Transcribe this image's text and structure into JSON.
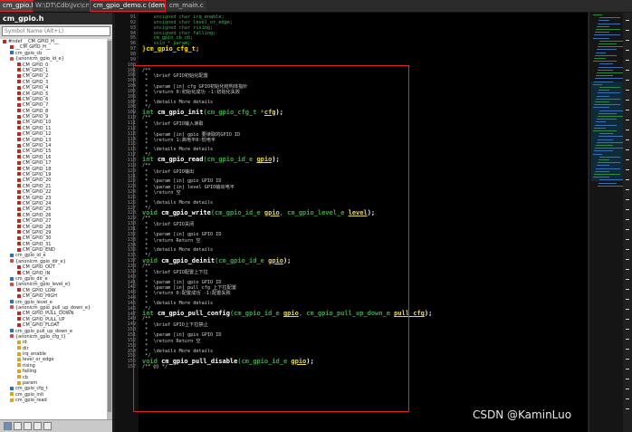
{
  "tabs": [
    {
      "label": "cm_gpio.h",
      "active": true
    },
    {
      "label": "W:\\DT\\Cdb\\Jvc\\cm\\",
      "active": false
    },
    {
      "label": "cm_gpio_demo.c (demo)",
      "active": true
    },
    {
      "label": "cm_main.c",
      "active": false
    }
  ],
  "symbol_panel": {
    "title": "cm_gpio.h",
    "search_placeholder": "Symbol Name (Alt+L)",
    "items": [
      {
        "label": "#ndef __CM_GPIO_H__",
        "icon": "define-icon",
        "depth": 0
      },
      {
        "label": "__CM_GPIO_H__",
        "icon": "define-icon",
        "depth": 1
      },
      {
        "label": "cm_gpio_cb",
        "icon": "type-icon",
        "depth": 1
      },
      {
        "label": "{anonicm_gpio_id_e}",
        "icon": "enum-icon",
        "depth": 1
      },
      {
        "label": "CM_GPIO_0",
        "icon": "define-icon",
        "depth": 2
      },
      {
        "label": "CM_GPIO_1",
        "icon": "define-icon",
        "depth": 2
      },
      {
        "label": "CM_GPIO_2",
        "icon": "define-icon",
        "depth": 2
      },
      {
        "label": "CM_GPIO_3",
        "icon": "define-icon",
        "depth": 2
      },
      {
        "label": "CM_GPIO_4",
        "icon": "define-icon",
        "depth": 2
      },
      {
        "label": "CM_GPIO_5",
        "icon": "define-icon",
        "depth": 2
      },
      {
        "label": "CM_GPIO_6",
        "icon": "define-icon",
        "depth": 2
      },
      {
        "label": "CM_GPIO_7",
        "icon": "define-icon",
        "depth": 2
      },
      {
        "label": "CM_GPIO_8",
        "icon": "define-icon",
        "depth": 2
      },
      {
        "label": "CM_GPIO_9",
        "icon": "define-icon",
        "depth": 2
      },
      {
        "label": "CM_GPIO_10",
        "icon": "define-icon",
        "depth": 2
      },
      {
        "label": "CM_GPIO_11",
        "icon": "define-icon",
        "depth": 2
      },
      {
        "label": "CM_GPIO_12",
        "icon": "define-icon",
        "depth": 2
      },
      {
        "label": "CM_GPIO_13",
        "icon": "define-icon",
        "depth": 2
      },
      {
        "label": "CM_GPIO_14",
        "icon": "define-icon",
        "depth": 2
      },
      {
        "label": "CM_GPIO_15",
        "icon": "define-icon",
        "depth": 2
      },
      {
        "label": "CM_GPIO_16",
        "icon": "define-icon",
        "depth": 2
      },
      {
        "label": "CM_GPIO_17",
        "icon": "define-icon",
        "depth": 2
      },
      {
        "label": "CM_GPIO_18",
        "icon": "define-icon",
        "depth": 2
      },
      {
        "label": "CM_GPIO_19",
        "icon": "define-icon",
        "depth": 2
      },
      {
        "label": "CM_GPIO_20",
        "icon": "define-icon",
        "depth": 2
      },
      {
        "label": "CM_GPIO_21",
        "icon": "define-icon",
        "depth": 2
      },
      {
        "label": "CM_GPIO_22",
        "icon": "define-icon",
        "depth": 2
      },
      {
        "label": "CM_GPIO_23",
        "icon": "define-icon",
        "depth": 2
      },
      {
        "label": "CM_GPIO_24",
        "icon": "define-icon",
        "depth": 2
      },
      {
        "label": "CM_GPIO_25",
        "icon": "define-icon",
        "depth": 2
      },
      {
        "label": "CM_GPIO_26",
        "icon": "define-icon",
        "depth": 2
      },
      {
        "label": "CM_GPIO_27",
        "icon": "define-icon",
        "depth": 2
      },
      {
        "label": "CM_GPIO_28",
        "icon": "define-icon",
        "depth": 2
      },
      {
        "label": "CM_GPIO_29",
        "icon": "define-icon",
        "depth": 2
      },
      {
        "label": "CM_GPIO_30",
        "icon": "define-icon",
        "depth": 2
      },
      {
        "label": "CM_GPIO_31",
        "icon": "define-icon",
        "depth": 2
      },
      {
        "label": "CM_GPIO_END",
        "icon": "define-icon",
        "depth": 2
      },
      {
        "label": "cm_gpio_id_e",
        "icon": "type-icon",
        "depth": 1
      },
      {
        "label": "{anonicm_gpio_dir_e}",
        "icon": "enum-icon",
        "depth": 1
      },
      {
        "label": "CM_GPIO_OUT",
        "icon": "define-icon",
        "depth": 2
      },
      {
        "label": "CM_GPIO_IN",
        "icon": "define-icon",
        "depth": 2
      },
      {
        "label": "cm_gpio_dir_e",
        "icon": "type-icon",
        "depth": 1
      },
      {
        "label": "{anonicm_gpio_level_e}",
        "icon": "enum-icon",
        "depth": 1
      },
      {
        "label": "CM_GPIO_LOW",
        "icon": "define-icon",
        "depth": 2
      },
      {
        "label": "CM_GPIO_HIGH",
        "icon": "define-icon",
        "depth": 2
      },
      {
        "label": "cm_gpio_level_e",
        "icon": "type-icon",
        "depth": 1
      },
      {
        "label": "{anonicm_gpio_pull_up_down_e}",
        "icon": "enum-icon",
        "depth": 1
      },
      {
        "label": "CM_GPIO_PULL_DOWN",
        "icon": "define-icon",
        "depth": 2
      },
      {
        "label": "CM_GPIO_PULL_UP",
        "icon": "define-icon",
        "depth": 2
      },
      {
        "label": "CM_GPIO_FLOAT",
        "icon": "define-icon",
        "depth": 2
      },
      {
        "label": "cm_gpio_pull_up_down_e",
        "icon": "type-icon",
        "depth": 1
      },
      {
        "label": "{anonicm_gpio_cfg_t}",
        "icon": "enum-icon",
        "depth": 1
      },
      {
        "label": "id",
        "icon": "field-icon",
        "depth": 2
      },
      {
        "label": "dir",
        "icon": "field-icon",
        "depth": 2
      },
      {
        "label": "irq_enable",
        "icon": "field-icon",
        "depth": 2
      },
      {
        "label": "level_or_edge",
        "icon": "field-icon",
        "depth": 2
      },
      {
        "label": "rising",
        "icon": "field-icon",
        "depth": 2
      },
      {
        "label": "falling",
        "icon": "field-icon",
        "depth": 2
      },
      {
        "label": "cb",
        "icon": "field-icon",
        "depth": 2
      },
      {
        "label": "param",
        "icon": "field-icon",
        "depth": 2
      },
      {
        "label": "cm_gpio_cfg_t",
        "icon": "type-icon",
        "depth": 1
      },
      {
        "label": "cm_gpio_init",
        "icon": "field-icon",
        "depth": 1
      },
      {
        "label": "cm_gpio_read",
        "icon": "field-icon",
        "depth": 1
      }
    ]
  },
  "editor": {
    "lines": [
      {
        "n": "91",
        "tokens": [
          {
            "t": "    unsigned char ",
            "c": "kw"
          },
          {
            "t": "irq_enable;",
            "c": "ty"
          }
        ]
      },
      {
        "n": "92",
        "tokens": [
          {
            "t": "    unsigned char ",
            "c": "kw"
          },
          {
            "t": "level_or_edge;",
            "c": "ty"
          }
        ]
      },
      {
        "n": "93",
        "tokens": [
          {
            "t": "    unsigned char ",
            "c": "kw"
          },
          {
            "t": "rising;",
            "c": "ty"
          }
        ]
      },
      {
        "n": "94",
        "tokens": [
          {
            "t": "    unsigned char ",
            "c": "kw"
          },
          {
            "t": "falling;",
            "c": "ty"
          }
        ]
      },
      {
        "n": "95",
        "tokens": [
          {
            "t": "    cm_gpio_cb cb;",
            "c": "ty"
          }
        ]
      },
      {
        "n": "96",
        "tokens": [
          {
            "t": "    void * ",
            "c": "kw"
          },
          {
            "t": "param;",
            "c": "ty"
          }
        ]
      },
      {
        "n": "97",
        "big": true,
        "tokens": [
          {
            "t": "}",
            "c": "yl"
          },
          {
            "t": "cm_gpio_cfg_t",
            "c": "yl"
          },
          {
            "t": ";",
            "c": "yl"
          }
        ]
      },
      {
        "n": "98",
        "tokens": []
      },
      {
        "n": "99",
        "tokens": []
      },
      {
        "n": "100",
        "tokens": []
      },
      {
        "n": "101",
        "tokens": [
          {
            "t": "/**",
            "c": "cm"
          }
        ]
      },
      {
        "n": "102",
        "tokens": [
          {
            "t": " *  \\brief GPIO初始化配置",
            "c": "cm"
          }
        ]
      },
      {
        "n": "103",
        "tokens": [
          {
            "t": " *",
            "c": "cm"
          }
        ]
      },
      {
        "n": "104",
        "tokens": [
          {
            "t": " *  \\param [in] cfg GPIO初始化结构体指针",
            "c": "cm"
          }
        ]
      },
      {
        "n": "105",
        "tokens": [
          {
            "t": " *  \\return 0:初始化成功 -1:初始化失败",
            "c": "cm"
          }
        ]
      },
      {
        "n": "106",
        "tokens": [
          {
            "t": " *",
            "c": "cm"
          }
        ]
      },
      {
        "n": "107",
        "tokens": [
          {
            "t": " *  \\details More details",
            "c": "cm"
          }
        ]
      },
      {
        "n": "108",
        "tokens": [
          {
            "t": " */",
            "c": "cm"
          }
        ]
      },
      {
        "n": "109",
        "big": true,
        "tokens": [
          {
            "t": "int ",
            "c": "kw"
          },
          {
            "t": "cm_gpio_init",
            "c": "fn"
          },
          {
            "t": "(cm_gpio_cfg_t *",
            "c": "kw"
          },
          {
            "t": "cfg",
            "c": "pa"
          },
          {
            "t": ");",
            "c": "fn"
          }
        ]
      },
      {
        "n": "110",
        "tokens": [
          {
            "t": "/**",
            "c": "cm"
          }
        ]
      },
      {
        "n": "111",
        "tokens": [
          {
            "t": " *  \\brief GPIO输入读取",
            "c": "cm"
          }
        ]
      },
      {
        "n": "112",
        "tokens": [
          {
            "t": " *",
            "c": "cm"
          }
        ]
      },
      {
        "n": "113",
        "tokens": [
          {
            "t": " *  \\param [in] gpio 要读取的GPIO ID",
            "c": "cm"
          }
        ]
      },
      {
        "n": "114",
        "tokens": [
          {
            "t": " *  \\return 1:高电平0:低电平",
            "c": "cm"
          }
        ]
      },
      {
        "n": "115",
        "tokens": [
          {
            "t": " *",
            "c": "cm"
          }
        ]
      },
      {
        "n": "116",
        "tokens": [
          {
            "t": " *  \\details More details",
            "c": "cm"
          }
        ]
      },
      {
        "n": "117",
        "tokens": [
          {
            "t": " */",
            "c": "cm"
          }
        ]
      },
      {
        "n": "118",
        "big": true,
        "tokens": [
          {
            "t": "int ",
            "c": "kw"
          },
          {
            "t": "cm_gpio_read",
            "c": "fn"
          },
          {
            "t": "(cm_gpio_id_e ",
            "c": "kw"
          },
          {
            "t": "gpio",
            "c": "pa"
          },
          {
            "t": ");",
            "c": "fn"
          }
        ]
      },
      {
        "n": "119",
        "tokens": [
          {
            "t": "/**",
            "c": "cm"
          }
        ]
      },
      {
        "n": "120",
        "tokens": [
          {
            "t": " *  \\brief GPIO输出",
            "c": "cm"
          }
        ]
      },
      {
        "n": "121",
        "tokens": [
          {
            "t": " *",
            "c": "cm"
          }
        ]
      },
      {
        "n": "122",
        "tokens": [
          {
            "t": " *  \\param [in] gpio GPIO ID",
            "c": "cm"
          }
        ]
      },
      {
        "n": "123",
        "tokens": [
          {
            "t": " *  \\param [in] level GPIO输出电平",
            "c": "cm"
          }
        ]
      },
      {
        "n": "124",
        "tokens": [
          {
            "t": " *  \\return 空",
            "c": "cm"
          }
        ]
      },
      {
        "n": "125",
        "tokens": [
          {
            "t": " *",
            "c": "cm"
          }
        ]
      },
      {
        "n": "126",
        "tokens": [
          {
            "t": " *  \\details More details",
            "c": "cm"
          }
        ]
      },
      {
        "n": "127",
        "tokens": [
          {
            "t": " */",
            "c": "cm"
          }
        ]
      },
      {
        "n": "128",
        "big": true,
        "tokens": [
          {
            "t": "void ",
            "c": "kw"
          },
          {
            "t": "cm_gpio_write",
            "c": "fn"
          },
          {
            "t": "(cm_gpio_id_e ",
            "c": "kw"
          },
          {
            "t": "gpio",
            "c": "pa"
          },
          {
            "t": ", cm_gpio_level_e ",
            "c": "kw"
          },
          {
            "t": "level",
            "c": "pa"
          },
          {
            "t": ");",
            "c": "fn"
          }
        ]
      },
      {
        "n": "129",
        "tokens": [
          {
            "t": "/**",
            "c": "cm"
          }
        ]
      },
      {
        "n": "130",
        "tokens": [
          {
            "t": " *  \\brief GPIO关闭",
            "c": "cm"
          }
        ]
      },
      {
        "n": "131",
        "tokens": [
          {
            "t": " *",
            "c": "cm"
          }
        ]
      },
      {
        "n": "132",
        "tokens": [
          {
            "t": " *  \\param [in] gpio GPIO ID",
            "c": "cm"
          }
        ]
      },
      {
        "n": "133",
        "tokens": [
          {
            "t": " *  \\return Return 空",
            "c": "cm"
          }
        ]
      },
      {
        "n": "134",
        "tokens": [
          {
            "t": " *",
            "c": "cm"
          }
        ]
      },
      {
        "n": "135",
        "tokens": [
          {
            "t": " *  \\details More details",
            "c": "cm"
          }
        ]
      },
      {
        "n": "136",
        "tokens": [
          {
            "t": " */",
            "c": "cm"
          }
        ]
      },
      {
        "n": "137",
        "big": true,
        "tokens": [
          {
            "t": "void ",
            "c": "kw"
          },
          {
            "t": "cm_gpio_deinit",
            "c": "fn"
          },
          {
            "t": "(cm_gpio_id_e ",
            "c": "kw"
          },
          {
            "t": "gpio",
            "c": "pa"
          },
          {
            "t": ");",
            "c": "fn"
          }
        ]
      },
      {
        "n": "138",
        "tokens": [
          {
            "t": "/**",
            "c": "cm"
          }
        ]
      },
      {
        "n": "139",
        "tokens": [
          {
            "t": " *  \\brief GPIO配置上下拉",
            "c": "cm"
          }
        ]
      },
      {
        "n": "140",
        "tokens": [
          {
            "t": " *",
            "c": "cm"
          }
        ]
      },
      {
        "n": "141",
        "tokens": [
          {
            "t": " *  \\param [in] gpio GPIO ID",
            "c": "cm"
          }
        ]
      },
      {
        "n": "142",
        "tokens": [
          {
            "t": " *  \\param [in] pull_cfg 上下拉配置",
            "c": "cm"
          }
        ]
      },
      {
        "n": "143",
        "tokens": [
          {
            "t": " *  \\return 0:配置成功 -1:配置失败",
            "c": "cm"
          }
        ]
      },
      {
        "n": "144",
        "tokens": [
          {
            "t": " *",
            "c": "cm"
          }
        ]
      },
      {
        "n": "145",
        "tokens": [
          {
            "t": " *  \\details More details",
            "c": "cm"
          }
        ]
      },
      {
        "n": "146",
        "tokens": [
          {
            "t": " */",
            "c": "cm"
          }
        ]
      },
      {
        "n": "147",
        "big": true,
        "tokens": [
          {
            "t": "int ",
            "c": "kw"
          },
          {
            "t": "cm_gpio_pull_config",
            "c": "fn"
          },
          {
            "t": "(cm_gpio_id_e ",
            "c": "kw"
          },
          {
            "t": "gpio",
            "c": "pa"
          },
          {
            "t": ", cm_gpio_pull_up_down_e ",
            "c": "kw"
          },
          {
            "t": "pull_cfg",
            "c": "pa"
          },
          {
            "t": ");",
            "c": "fn"
          }
        ]
      },
      {
        "n": "148",
        "tokens": [
          {
            "t": "/**",
            "c": "cm"
          }
        ]
      },
      {
        "n": "149",
        "tokens": [
          {
            "t": " *  \\brief GPIO上下拉禁止",
            "c": "cm"
          }
        ]
      },
      {
        "n": "150",
        "tokens": [
          {
            "t": " *",
            "c": "cm"
          }
        ]
      },
      {
        "n": "151",
        "tokens": [
          {
            "t": " *  \\param [in] gpio GPIO ID",
            "c": "cm"
          }
        ]
      },
      {
        "n": "152",
        "tokens": [
          {
            "t": " *  \\return Return 空",
            "c": "cm"
          }
        ]
      },
      {
        "n": "153",
        "tokens": [
          {
            "t": " *",
            "c": "cm"
          }
        ]
      },
      {
        "n": "154",
        "tokens": [
          {
            "t": " *  \\details More details",
            "c": "cm"
          }
        ]
      },
      {
        "n": "155",
        "tokens": [
          {
            "t": " */",
            "c": "cm"
          }
        ]
      },
      {
        "n": "156",
        "big": true,
        "tokens": [
          {
            "t": "void ",
            "c": "kw"
          },
          {
            "t": "cm_gpio_pull_disable",
            "c": "fn"
          },
          {
            "t": "(cm_gpio_id_e ",
            "c": "kw"
          },
          {
            "t": "gpio",
            "c": "pa"
          },
          {
            "t": ");",
            "c": "fn"
          }
        ]
      },
      {
        "n": "157",
        "tokens": [
          {
            "t": "/** @} */",
            "c": "cm"
          }
        ]
      }
    ]
  },
  "colors": {
    "highlight_box": "#e0242b",
    "editor_bg": "#000000",
    "keyword": "#3fa34d",
    "param": "#e4d84c"
  },
  "watermark": "CSDN @KaminLuo"
}
